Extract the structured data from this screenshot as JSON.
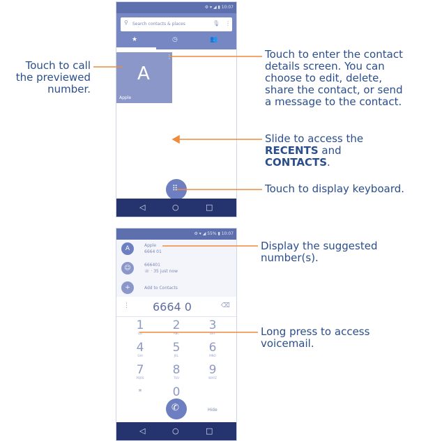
{
  "phone1": {
    "status_text": "⚙ ▾ ◢ ▮ 10:07",
    "search_placeholder": "Search contacts & places",
    "tabs": [
      "★",
      "◷",
      "👥"
    ],
    "contact_letter": "A",
    "contact_name": "Apple",
    "nav": [
      "◁",
      "○",
      "□"
    ]
  },
  "phone2": {
    "status_text": "⚙ ▾ ◢ 55% ▮ 10:07",
    "suggestions": [
      {
        "name": "Apple",
        "number": "6664 01"
      },
      {
        "name": "666401",
        "number": "☏ · 35 just now"
      },
      {
        "name": "Add to Contacts",
        "number": ""
      }
    ],
    "dial_number": "6664 0",
    "keys": [
      {
        "digit": "1",
        "letters": "QO"
      },
      {
        "digit": "2",
        "letters": "ABC"
      },
      {
        "digit": "3",
        "letters": "DEF"
      },
      {
        "digit": "4",
        "letters": "GHI"
      },
      {
        "digit": "5",
        "letters": "JKL"
      },
      {
        "digit": "6",
        "letters": "MNO"
      },
      {
        "digit": "7",
        "letters": "PQRS"
      },
      {
        "digit": "8",
        "letters": "TUV"
      },
      {
        "digit": "9",
        "letters": "WXYZ"
      },
      {
        "digit": "*",
        "letters": ""
      },
      {
        "digit": "0",
        "letters": "+"
      },
      {
        "digit": "#",
        "letters": ""
      }
    ],
    "hide_label": "Hide",
    "nav": [
      "◁",
      "○",
      "□"
    ]
  },
  "annotations": {
    "call_line1": "Touch to call",
    "call_line2": "the previewed",
    "call_line3": "number.",
    "details_line1": "Touch to enter the contact",
    "details_line2": "details screen. You can",
    "details_line3": "choose to edit, delete,",
    "details_line4": "share the contact, or send",
    "details_line5": "a message to the contact.",
    "slide_line1": "Slide to access the",
    "slide_recents": "RECENTS",
    "slide_and": " and",
    "slide_contacts": "CONTACTS",
    "slide_period": ".",
    "keyboard": "Touch to display keyboard.",
    "suggest_line1": "Display the suggested",
    "suggest_line2": "number(s).",
    "voicemail_line1": "Long press to access",
    "voicemail_line2": "voicemail."
  },
  "colors": {
    "annotation_text": "#2a4e8c",
    "leader_line": "#f08a3c",
    "status_bar": "#5e6fae",
    "nav_bar": "#25336e",
    "contact_tile": "#8c97c9",
    "fab": "#6d7fc0"
  }
}
